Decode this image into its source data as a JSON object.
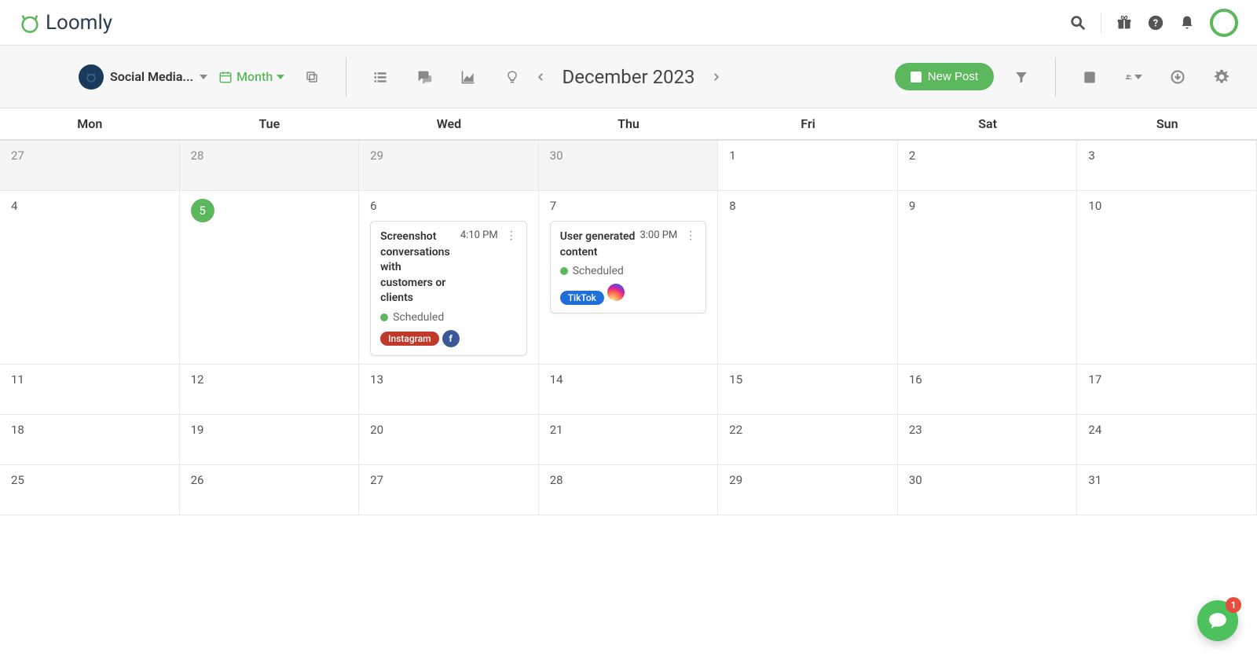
{
  "brand": {
    "name": "Loomly"
  },
  "header": {
    "gift": "gift",
    "help": "help",
    "bell": "notifications"
  },
  "toolbar": {
    "calendar_name": "Social Media...",
    "view_label": "Month",
    "month_title": "December 2023",
    "new_post_label": "New Post"
  },
  "day_headers": [
    "Mon",
    "Tue",
    "Wed",
    "Thu",
    "Fri",
    "Sat",
    "Sun"
  ],
  "weeks": [
    [
      {
        "num": "27",
        "other": true
      },
      {
        "num": "28",
        "other": true
      },
      {
        "num": "29",
        "other": true
      },
      {
        "num": "30",
        "other": true
      },
      {
        "num": "1"
      },
      {
        "num": "2"
      },
      {
        "num": "3"
      }
    ],
    [
      {
        "num": "4"
      },
      {
        "num": "5",
        "today": true
      },
      {
        "num": "6",
        "posts": [
          {
            "title": "Screenshot conversations with customers or clients",
            "time": "4:10 PM",
            "status": "Scheduled",
            "tag": "Instagram",
            "tagClass": "instagram",
            "channel": "fb"
          }
        ]
      },
      {
        "num": "7",
        "posts": [
          {
            "title": "User generated content",
            "time": "3:00 PM",
            "status": "Scheduled",
            "tag": "TikTok",
            "tagClass": "tiktok",
            "channel": "ig"
          }
        ]
      },
      {
        "num": "8"
      },
      {
        "num": "9"
      },
      {
        "num": "10"
      }
    ],
    [
      {
        "num": "11"
      },
      {
        "num": "12"
      },
      {
        "num": "13"
      },
      {
        "num": "14"
      },
      {
        "num": "15"
      },
      {
        "num": "16"
      },
      {
        "num": "17"
      }
    ],
    [
      {
        "num": "18"
      },
      {
        "num": "19"
      },
      {
        "num": "20"
      },
      {
        "num": "21"
      },
      {
        "num": "22"
      },
      {
        "num": "23"
      },
      {
        "num": "24"
      }
    ],
    [
      {
        "num": "25"
      },
      {
        "num": "26"
      },
      {
        "num": "27"
      },
      {
        "num": "28"
      },
      {
        "num": "29"
      },
      {
        "num": "30"
      },
      {
        "num": "31"
      }
    ]
  ],
  "chat": {
    "badge": "1"
  }
}
